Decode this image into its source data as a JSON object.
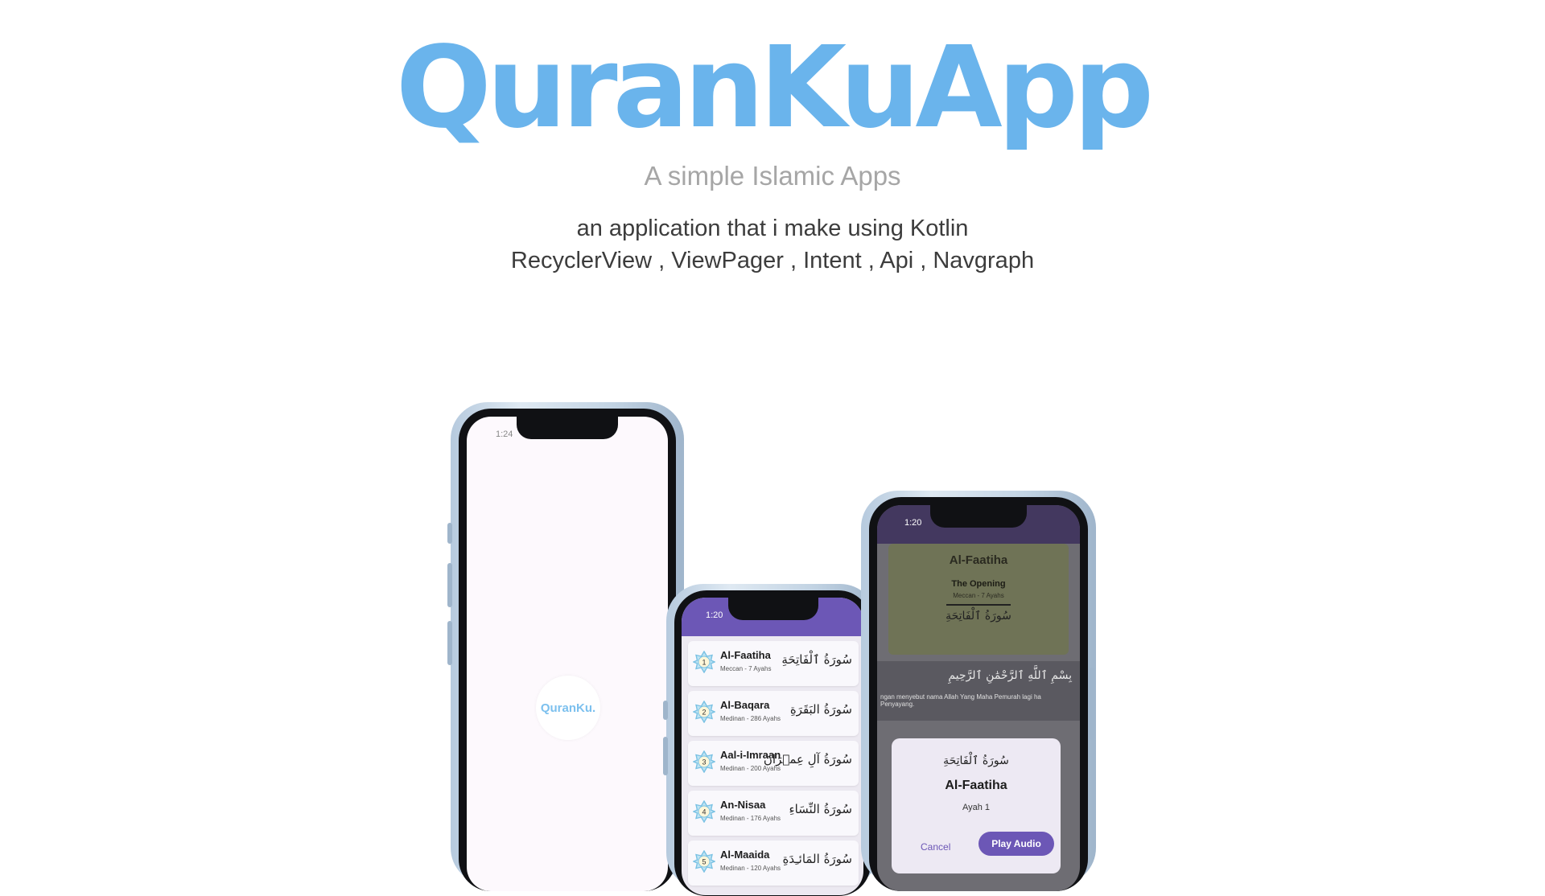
{
  "header": {
    "title": "QuranKuApp",
    "subtitle": "A simple Islamic Apps",
    "description_line1": "an application that i make using Kotlin",
    "description_line2": "RecyclerView , ViewPager , Intent , Api , Navgraph"
  },
  "colors": {
    "title": "#6ab4ec",
    "accent": "#6c57b6",
    "frame": "#b6cade"
  },
  "splash_phone": {
    "status_time": "1:24",
    "logo_text": "QuranKu."
  },
  "list_phone": {
    "status_time": "1:20",
    "surahs": [
      {
        "number": "1",
        "name": "Al-Faatiha",
        "meta": "Meccan - 7 Ayahs",
        "arabic": "سُورَةُ ٱلْفَاتِحَةِ"
      },
      {
        "number": "2",
        "name": "Al-Baqara",
        "meta": "Medinan - 286 Ayahs",
        "arabic": "سُورَةُ البَقَرَةِ"
      },
      {
        "number": "3",
        "name": "Aal-i-Imraan",
        "meta": "Medinan - 200 Ayahs",
        "arabic": "سُورَةُ آلِ عِمۡرَانَ"
      },
      {
        "number": "4",
        "name": "An-Nisaa",
        "meta": "Medinan - 176 Ayahs",
        "arabic": "سُورَةُ النِّسَاءِ"
      },
      {
        "number": "5",
        "name": "Al-Maaida",
        "meta": "Medinan - 120 Ayahs",
        "arabic": "سُورَةُ المَائـِدَةِ"
      }
    ]
  },
  "detail_phone": {
    "status_time": "1:20",
    "surah_name": "Al-Faatiha",
    "translation": "The Opening",
    "meta": "Meccan - 7 Ayahs",
    "arabic": "سُورَةُ ٱلْفَاتِحَةِ",
    "verse_arabic": "بِسْمِ ٱللَّهِ ٱلرَّحْمَٰنِ ٱلرَّحِيمِ",
    "verse_translation": "ngan menyebut nama Allah Yang Maha Pemurah lagi ha Penyayang.",
    "dialog": {
      "arabic": "سُورَةُ ٱلْفَاتِحَةِ",
      "title": "Al-Faatiha",
      "ayah": "Ayah 1",
      "cancel_label": "Cancel",
      "play_label": "Play Audio"
    }
  }
}
